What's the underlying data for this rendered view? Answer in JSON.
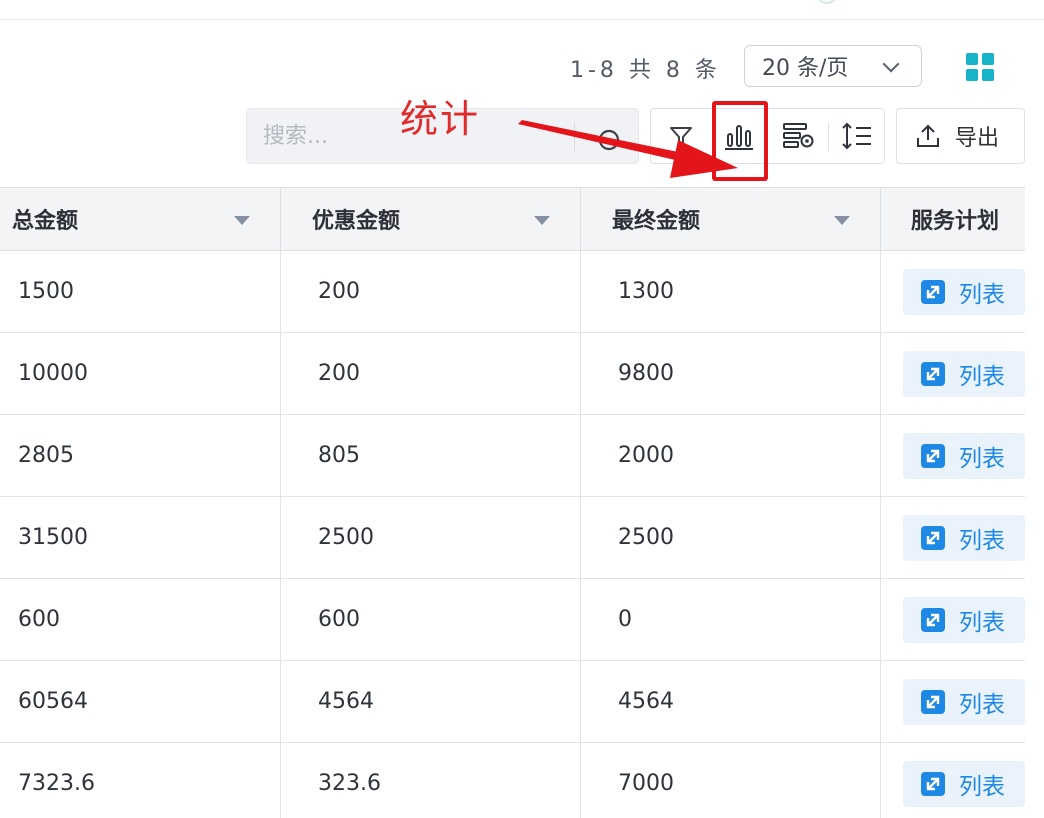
{
  "annotation": {
    "label": "统计"
  },
  "pagination": {
    "count_text": "1-8 共 8 条",
    "page_size": "20 条/页"
  },
  "toolbar": {
    "search_placeholder": "搜索...",
    "export_label": "导出"
  },
  "icons": {
    "search": "search-icon",
    "filter": "filter-icon",
    "statistics": "bar-chart-icon",
    "column_settings": "column-settings-icon",
    "row_height": "row-height-icon",
    "export": "upload-icon",
    "view_toggle": "grid-view-icon",
    "row_action": "expand-icon"
  },
  "colors": {
    "annotation": "#e4141b",
    "accent": "#1e88e5",
    "grid_icon": "#17b3c7"
  },
  "table": {
    "columns": [
      "总金额",
      "优惠金额",
      "最终金额",
      "服务计划"
    ],
    "rows": [
      {
        "total": "1500",
        "discount": "200",
        "final": "1300",
        "plan": "列表"
      },
      {
        "total": "10000",
        "discount": "200",
        "final": "9800",
        "plan": "列表"
      },
      {
        "total": "2805",
        "discount": "805",
        "final": "2000",
        "plan": "列表"
      },
      {
        "total": "31500",
        "discount": "2500",
        "final": "2500",
        "plan": "列表"
      },
      {
        "total": "600",
        "discount": "600",
        "final": "0",
        "plan": "列表"
      },
      {
        "total": "60564",
        "discount": "4564",
        "final": "4564",
        "plan": "列表"
      },
      {
        "total": "7323.6",
        "discount": "323.6",
        "final": "7000",
        "plan": "列表"
      }
    ]
  }
}
